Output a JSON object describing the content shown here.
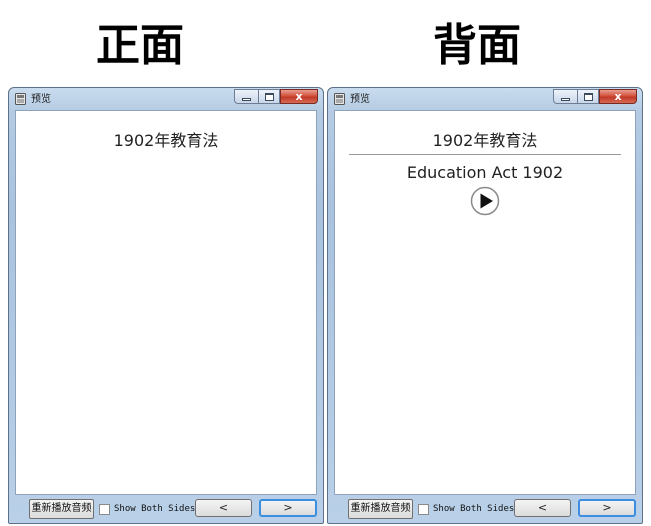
{
  "headers": {
    "front": "正面",
    "back": "背面"
  },
  "window": {
    "title": "预览"
  },
  "card": {
    "front": "1902年教育法",
    "back_answer": "Education Act 1902"
  },
  "toolbar": {
    "replay_label": "重新播放音频",
    "show_both_label": "Show Both Sides",
    "prev_label": "<",
    "next_label": ">"
  },
  "caption": {
    "close_label": "x"
  },
  "colors": {
    "accent": "#3d8ee0",
    "close": "#c23a27",
    "frame": "#a9c2de"
  }
}
